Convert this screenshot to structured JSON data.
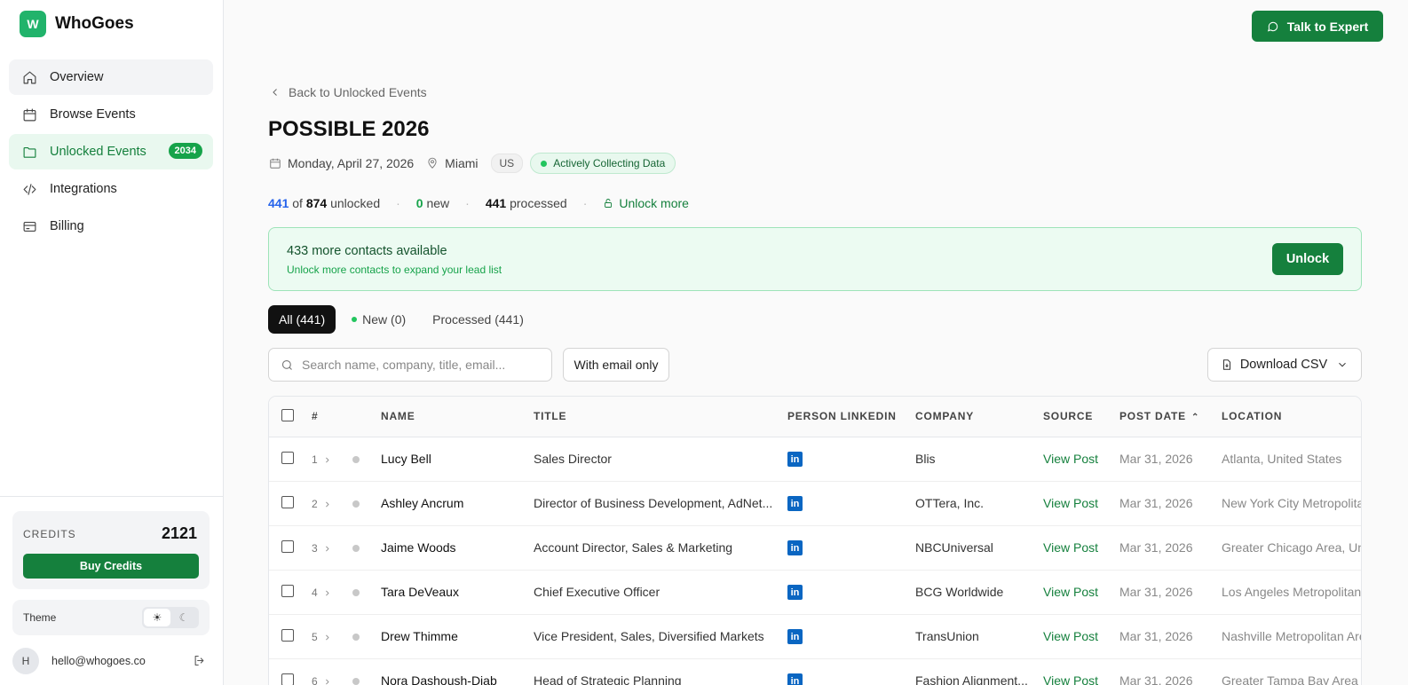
{
  "app": {
    "logo_letter": "W",
    "name": "WhoGoes"
  },
  "sidebar": {
    "items": [
      {
        "label": "Overview",
        "icon": "home-icon"
      },
      {
        "label": "Browse Events",
        "icon": "calendar-icon"
      },
      {
        "label": "Unlocked Events",
        "icon": "folder-icon",
        "badge": "2034"
      },
      {
        "label": "Integrations",
        "icon": "code-icon"
      },
      {
        "label": "Billing",
        "icon": "card-icon"
      }
    ],
    "credits_label": "CREDITS",
    "credits_value": "2121",
    "buy_credits": "Buy Credits",
    "theme_label": "Theme",
    "user_initial": "H",
    "user_email": "hello@whogoes.co"
  },
  "header": {
    "talk_to_expert": "Talk to Expert"
  },
  "event": {
    "back_label": "Back to Unlocked Events",
    "title": "POSSIBLE 2026",
    "date": "Monday, April 27, 2026",
    "city": "Miami",
    "country": "US",
    "status": "Actively Collecting Data"
  },
  "stats": {
    "unlocked": "441",
    "of": "of",
    "total": "874",
    "unlocked_label": "unlocked",
    "new_count": "0",
    "new_label": "new",
    "processed_count": "441",
    "processed_label": "processed",
    "unlock_more": "Unlock more"
  },
  "banner": {
    "title": "433 more contacts available",
    "subtitle": "Unlock more contacts to expand your lead list",
    "button": "Unlock"
  },
  "tabs": {
    "all": "All (441)",
    "new": "New (0)",
    "processed": "Processed (441)"
  },
  "toolbar": {
    "search_placeholder": "Search name, company, title, email...",
    "email_only": "With email only",
    "download": "Download CSV"
  },
  "table": {
    "columns": {
      "num": "#",
      "name": "NAME",
      "title": "TITLE",
      "linkedin": "PERSON LINKEDIN",
      "company": "COMPANY",
      "source": "SOURCE",
      "post_date": "POST DATE",
      "location": "LOCATION"
    },
    "rows": [
      {
        "num": "1",
        "name": "Lucy Bell",
        "title": "Sales Director",
        "company": "Blis",
        "source": "View Post",
        "date": "Mar 31, 2026",
        "location": "Atlanta, United States"
      },
      {
        "num": "2",
        "name": "Ashley Ancrum",
        "title": "Director of Business Development, AdNet...",
        "company": "OTTera, Inc.",
        "source": "View Post",
        "date": "Mar 31, 2026",
        "location": "New York City Metropolitan Area"
      },
      {
        "num": "3",
        "name": "Jaime Woods",
        "title": "Account Director, Sales & Marketing",
        "company": "NBCUniversal",
        "source": "View Post",
        "date": "Mar 31, 2026",
        "location": "Greater Chicago Area, United States"
      },
      {
        "num": "4",
        "name": "Tara DeVeaux",
        "title": "Chief Executive Officer",
        "company": "BCG Worldwide",
        "source": "View Post",
        "date": "Mar 31, 2026",
        "location": "Los Angeles Metropolitan Area"
      },
      {
        "num": "5",
        "name": "Drew Thimme",
        "title": "Vice President, Sales, Diversified Markets",
        "company": "TransUnion",
        "source": "View Post",
        "date": "Mar 31, 2026",
        "location": "Nashville Metropolitan Area"
      },
      {
        "num": "6",
        "name": "Nora Dashoush-Diab",
        "title": "Head of Strategic Planning",
        "company": "Fashion Alignment...",
        "source": "View Post",
        "date": "Mar 31, 2026",
        "location": "Greater Tampa Bay Area"
      }
    ]
  },
  "colors": {
    "accent": "#15803d",
    "brand": "#21b36b",
    "linkedin": "#0a66c2"
  }
}
